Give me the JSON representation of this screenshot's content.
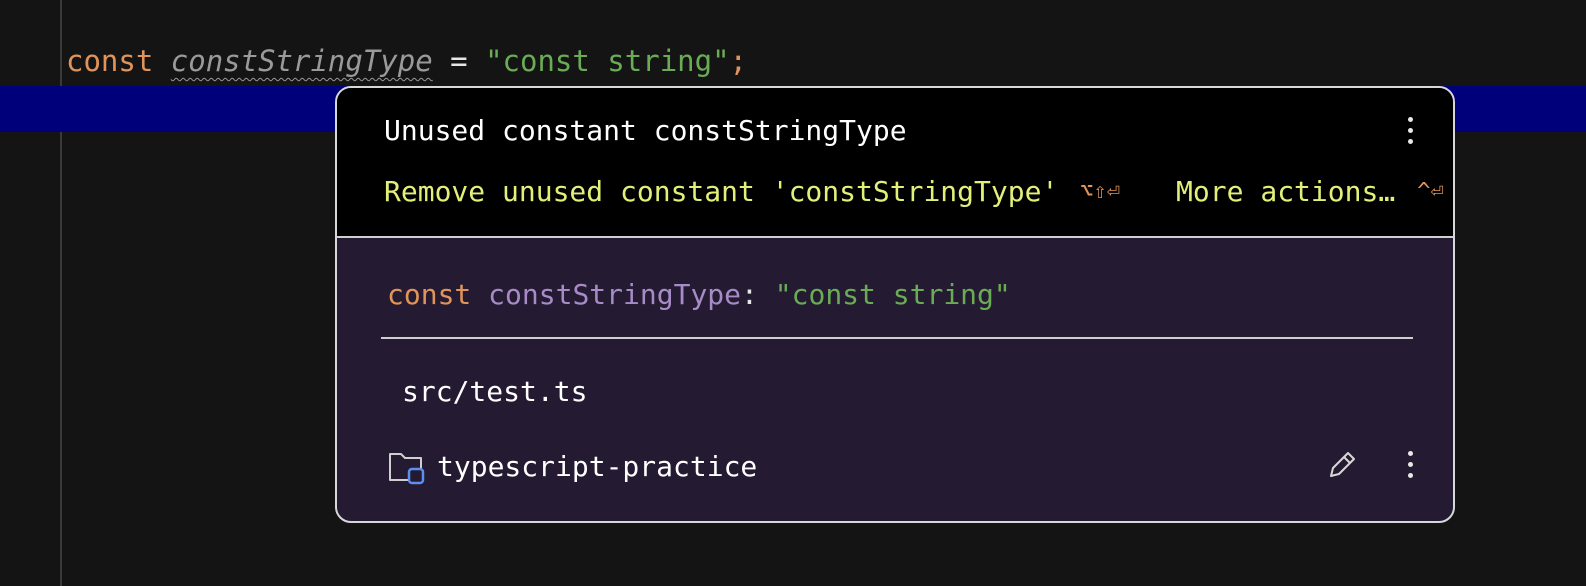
{
  "editor": {
    "code_line": {
      "keyword": "const",
      "identifier": "constStringType",
      "operator": "=",
      "string_literal": "\"const string\"",
      "terminator": ";"
    }
  },
  "popup": {
    "problem_title": "Unused constant constStringType",
    "fix_action": "Remove unused constant 'constStringType'",
    "fix_shortcut": "⌥⇧⏎",
    "more_actions": "More actions…",
    "more_actions_shortcut": "^⏎",
    "signature": {
      "keyword": "const",
      "name": "constStringType",
      "colon": ":",
      "type": "\"const string\""
    },
    "file_path": "src/test.ts",
    "project_name": "typescript-practice",
    "icons": {
      "menu": "kebab-menu-icon",
      "folder": "project-folder-icon",
      "edit": "pencil-icon"
    }
  },
  "colors": {
    "editor_background": "#141414",
    "highlight_row": "#00007a",
    "keyword": "#e0945a",
    "string": "#6aab55",
    "action_text": "#e2f07a",
    "popup_background": "#241a31"
  }
}
